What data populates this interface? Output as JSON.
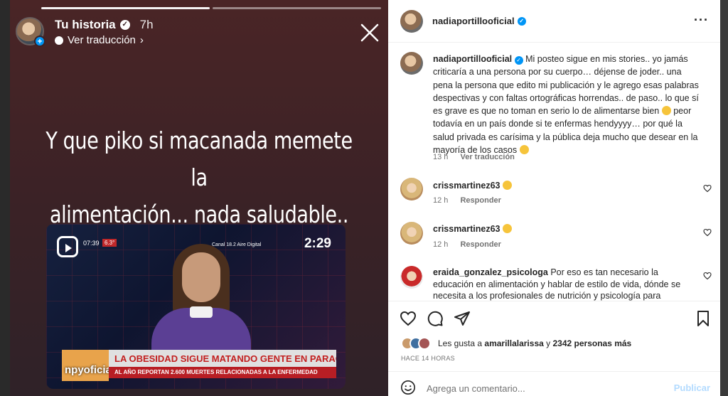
{
  "story": {
    "username": "Tu historia",
    "time": "7h",
    "translate_label": "Ver traducción",
    "text_line1": "Y que piko si macanada memete la",
    "text_line2": "alimentación... nada saludable..",
    "video": {
      "clock": "07:39",
      "temp": "6.3°",
      "channel": "Canal 18.2 Aire Digital",
      "duration": "2:29",
      "logo": "npyoficial",
      "headline": "LA OBESIDAD SIGUE MATANDO GENTE EN PARAGUAY",
      "subline": "AL AÑO REPORTAN 2.600 MUERTES RELACIONADAS A LA ENFERMEDAD"
    }
  },
  "post": {
    "username": "nadiaportillooficial",
    "more_label": "···",
    "caption": {
      "username": "nadiaportillooficial",
      "text_a": "Mi posteo sigue en mis stories.. yo jamás criticaría a una persona por su cuerpo… déjense de joder.. una pena la persona que edito mi publicación y le agrego esas palabras despectivas y con faltas ortográficas horrendas.. de paso.. lo que sí es grave es que no toman en serio lo de alimentarse bien",
      "text_b": "peor todavía en un país donde si te enfermas hendyyyy… por qué la salud privada es carísima y la pública deja mucho que desear en la mayoría de los casos",
      "time": "13 h",
      "translate": "Ver traducción"
    },
    "comments": [
      {
        "username": "crissmartinez63",
        "time": "12 h",
        "reply": "Responder"
      },
      {
        "username": "crissmartinez63",
        "time": "12 h",
        "reply": "Responder"
      },
      {
        "username": "eraida_gonzalez_psicologa",
        "text": "Por eso es tan necesario la educación en alimentación y hablar de estilo de vida, dónde se necesita a los profesionales de nutrición y psicología para"
      }
    ],
    "likes": {
      "prefix": "Les gusta a",
      "user": "amarillalarissa",
      "conj": "y",
      "others": "2342 personas más"
    },
    "posted_ago": "HACE 14 HORAS",
    "comment_placeholder": "Agrega un comentario...",
    "publish_label": "Publicar"
  }
}
